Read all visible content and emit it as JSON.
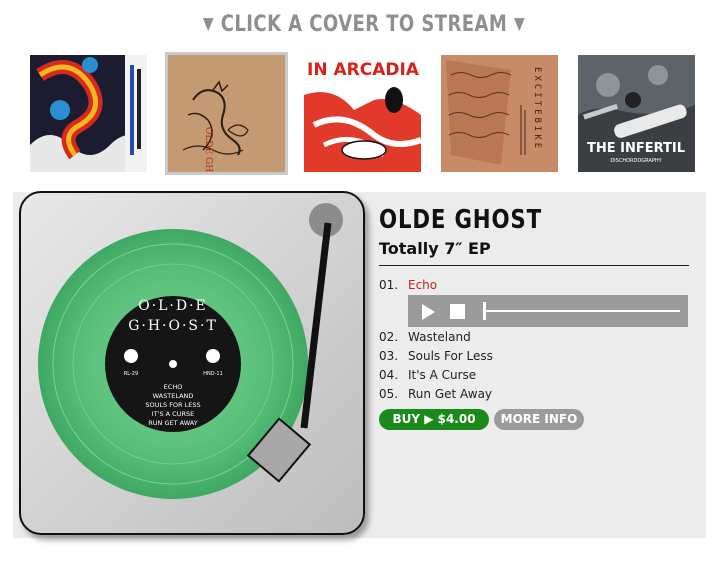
{
  "header": {
    "arrow": "▼",
    "label": "CLICK A COVER TO STREAM"
  },
  "covers": [
    {
      "name": "cover-dragon",
      "selected": false
    },
    {
      "name": "cover-olde-ghost",
      "selected": true,
      "text": "OLDE GHOST"
    },
    {
      "name": "cover-in-arcadia",
      "selected": false,
      "text": "IN ARCADIA"
    },
    {
      "name": "cover-excitebike",
      "selected": false,
      "text": "EXCITEBIKE"
    },
    {
      "name": "cover-the-infertil",
      "selected": false,
      "text": "THE INFERTIL",
      "subtext": "DISCHORDOGRAPHY"
    }
  ],
  "record": {
    "label_title_1": "O·L·D·E",
    "label_title_2": "G·H·O·S·T",
    "cat_left": "RL-29",
    "cat_right": "HND-11",
    "label_tracks": [
      "ECHO",
      "WASTELAND",
      "SOULS FOR LESS",
      "IT'S A CURSE",
      "RUN GET AWAY"
    ]
  },
  "info": {
    "artist": "OLDE GHOST",
    "album": "Totally 7″ EP"
  },
  "tracks": [
    {
      "num": "01.",
      "title": "Echo"
    },
    {
      "num": "02.",
      "title": "Wasteland"
    },
    {
      "num": "03.",
      "title": "Souls For Less"
    },
    {
      "num": "04.",
      "title": "It's A Curse"
    },
    {
      "num": "05.",
      "title": "Run Get Away"
    }
  ],
  "player": {
    "progress": 0.0
  },
  "buttons": {
    "buy": "BUY ▶ $4.00",
    "more": "MORE INFO"
  },
  "colors": {
    "accent_red": "#c0271f",
    "buy_green": "#1b8a1b",
    "vinyl_green": "#5cc27e"
  }
}
